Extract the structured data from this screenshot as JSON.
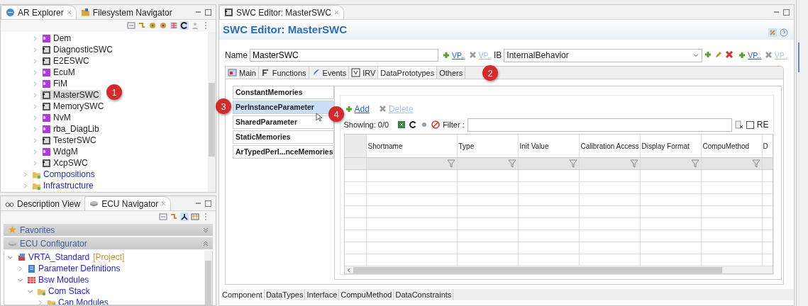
{
  "left_top": {
    "tabs": [
      {
        "label": "AR Explorer",
        "selected": true,
        "kind": "explorer"
      },
      {
        "label": "Filesystem Navigator",
        "selected": false,
        "kind": "filesystem"
      }
    ],
    "tree": [
      {
        "children": [
          {
            "label": "Dem",
            "kind": "bsw",
            "expanded": false,
            "selected": false
          },
          {
            "label": "DiagnosticSWC",
            "kind": "swc",
            "expanded": false,
            "selected": false
          },
          {
            "label": "E2ESWC",
            "kind": "swc",
            "expanded": false,
            "selected": false
          },
          {
            "label": "EcuM",
            "kind": "bsw",
            "expanded": false,
            "selected": false
          },
          {
            "label": "FiM",
            "kind": "bsw",
            "expanded": false,
            "selected": false
          },
          {
            "label": "MasterSWC",
            "kind": "swc",
            "expanded": false,
            "selected": true
          },
          {
            "label": "MemorySWC",
            "kind": "swc",
            "expanded": false,
            "selected": false
          },
          {
            "label": "NvM",
            "kind": "bsw",
            "expanded": false,
            "selected": false
          },
          {
            "label": "rba_DiagLib",
            "kind": "bsw",
            "expanded": false,
            "selected": false
          },
          {
            "label": "TesterSWC",
            "kind": "swc",
            "expanded": false,
            "selected": false
          },
          {
            "label": "WdgM",
            "kind": "bsw",
            "expanded": false,
            "selected": false
          },
          {
            "label": "XcpSWC",
            "kind": "swc",
            "expanded": false,
            "selected": false
          }
        ]
      },
      {
        "label": "Compositions",
        "kind": "folder",
        "expanded": false,
        "selected": false
      },
      {
        "label": "Infrastructure",
        "kind": "folder",
        "expanded": false,
        "selected": false
      }
    ]
  },
  "left_bottom": {
    "tabs": [
      {
        "label": "Description View",
        "selected": false,
        "kind": "description"
      },
      {
        "label": "ECU Navigator",
        "selected": true,
        "kind": "ecu"
      }
    ],
    "sections": [
      {
        "label": "Favorites",
        "kind": "star",
        "expanded": false
      },
      {
        "label": "ECU Configurator",
        "kind": "plugin",
        "expanded": true
      }
    ],
    "tree": [
      {
        "label": "VRTA_Standard",
        "suffix": "[Project]",
        "kind": "project",
        "expanded": true,
        "children": [
          {
            "label": "Parameter Definitions",
            "kind": "definitions",
            "expanded": false
          },
          {
            "label": "Bsw Modules",
            "kind": "modules",
            "expanded": true,
            "children": [
              {
                "label": "Com Stack",
                "kind": "folder",
                "expanded": true,
                "children": [
                  {
                    "label": "Can Modules",
                    "kind": "folder",
                    "expanded": false
                  }
                ]
              }
            ]
          }
        ]
      }
    ]
  },
  "editor": {
    "tab": {
      "label": "SWC Editor: MasterSWC"
    },
    "title": "SWC Editor: MasterSWC",
    "name_label": "Name",
    "name_value": "MasterSWC",
    "name_links": [
      {
        "label": "VP..",
        "disabled": false
      },
      {
        "label": "VP..",
        "disabled": true
      }
    ],
    "ib_label": "IB",
    "ib_value": "InternalBehavior",
    "ib_links": [
      {
        "label": "VP..",
        "disabled": false
      },
      {
        "label": "VP..",
        "disabled": true
      }
    ],
    "tabs": [
      {
        "label": "Main",
        "selected": false,
        "kind": "main"
      },
      {
        "label": "Functions",
        "selected": false,
        "kind": "functions"
      },
      {
        "label": "Events",
        "selected": false,
        "kind": "events"
      },
      {
        "label": "IRV",
        "selected": false,
        "kind": "irv"
      },
      {
        "label": "DataPrototypes",
        "selected": true,
        "kind": "none"
      },
      {
        "label": "Others",
        "selected": false,
        "kind": "none"
      }
    ],
    "categories": [
      {
        "label": "ConstantMemories",
        "selected": false
      },
      {
        "label": "PerInstanceParameter",
        "selected": true
      },
      {
        "label": "SharedParameter",
        "selected": false
      },
      {
        "label": "StaticMemories",
        "selected": false
      },
      {
        "label": "ArTypedPerI...nceMemories",
        "selected": false
      }
    ],
    "actions": [
      {
        "label": "Add",
        "kind": "add",
        "disabled": false
      },
      {
        "label": "Delete",
        "kind": "delete",
        "disabled": true
      }
    ],
    "showing": "Showing: 0/0",
    "filter_label": "Filter :",
    "re_label": "RE",
    "re_checked": false,
    "table": {
      "columns": [
        "Shortname",
        "Type",
        "Init Value",
        "Calibration Access",
        "Display Format",
        "CompuMethod",
        "D"
      ]
    },
    "bottom_tabs": [
      {
        "label": "Component",
        "selected": true
      },
      {
        "label": "DataTypes",
        "selected": false
      },
      {
        "label": "Interface",
        "selected": false
      },
      {
        "label": "CompuMethod",
        "selected": false
      },
      {
        "label": "DataConstraints",
        "selected": false
      }
    ]
  },
  "callouts": [
    {
      "label": "1"
    },
    {
      "label": "2"
    },
    {
      "label": "3"
    },
    {
      "label": "4"
    }
  ]
}
